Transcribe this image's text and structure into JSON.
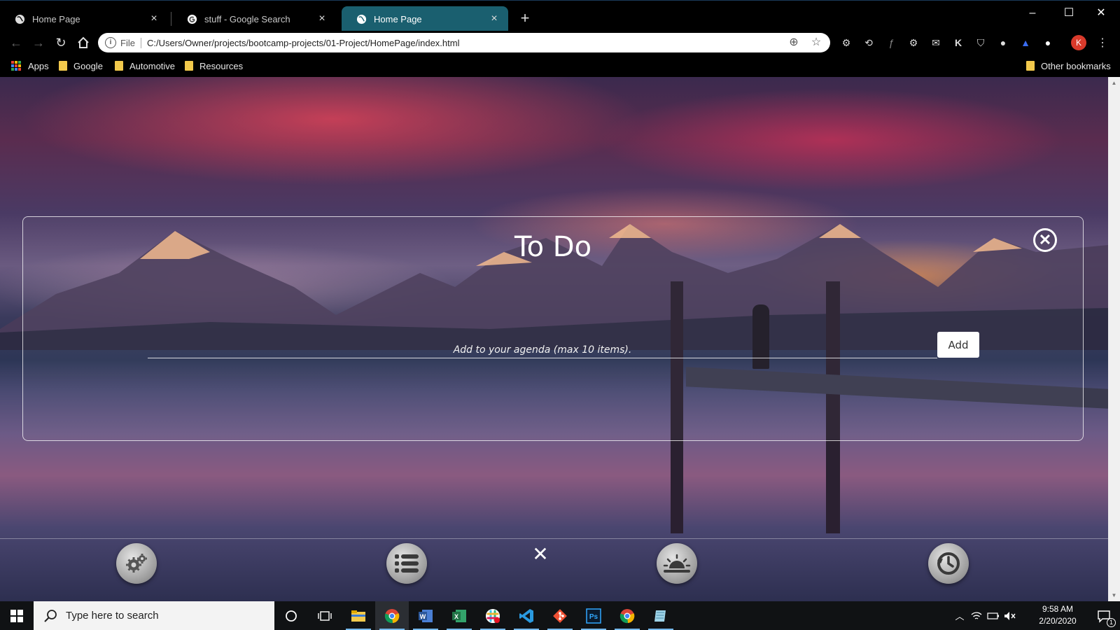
{
  "browser": {
    "tabs": [
      {
        "label": "Home Page",
        "icon": "globe-icon",
        "active": false
      },
      {
        "label": "stuff - Google Search",
        "icon": "google-icon",
        "active": false
      },
      {
        "label": "Home Page",
        "icon": "globe-icon",
        "active": true
      }
    ],
    "tab_close": "×",
    "new_tab": "+",
    "window_controls": {
      "minimize": "–",
      "maximize": "☐",
      "close": "✕"
    },
    "address": {
      "scheme": "File",
      "url": "C:/Users/Owner/projects/bootcamp-projects/01-Project/HomePage/index.html"
    },
    "profile_initial": "K",
    "extensions": [
      "gear-icon",
      "sync-icon",
      "fx-icon",
      "settings-icon",
      "mail-icon",
      "k-icon",
      "shield-icon",
      "circle-icon",
      "blue-icon",
      "white-circle-icon"
    ],
    "bookmarks": [
      {
        "label": "Apps",
        "icon": "apps-grid-icon"
      },
      {
        "label": "Google",
        "icon": "folder-icon"
      },
      {
        "label": "Automotive",
        "icon": "folder-icon"
      },
      {
        "label": "Resources",
        "icon": "folder-icon"
      }
    ],
    "other_bookmarks": "Other bookmarks"
  },
  "todo": {
    "title": "To Do",
    "input_placeholder": "Add to your agenda (max 10 items).",
    "add_label": "Add"
  },
  "dock": {
    "buttons": [
      "settings-gear-icon",
      "list-icon",
      "weather-sunrise-icon",
      "clock-history-icon"
    ],
    "close": "✕"
  },
  "taskbar": {
    "search_placeholder": "Type here to search",
    "apps": [
      "cortana-icon",
      "task-view-icon",
      "file-explorer-icon",
      "chrome-icon",
      "word-icon",
      "excel-icon",
      "slack-icon",
      "vscode-icon",
      "git-icon",
      "photoshop-icon",
      "chrome-icon",
      "notes-icon"
    ],
    "time": "9:58 AM",
    "date": "2/20/2020",
    "notification_count": "1"
  },
  "colors": {
    "active_tab": "#1a5f6f",
    "taskbar": "#101214",
    "accent_blue": "#76b9ed",
    "profile_red": "#d93a2b"
  }
}
